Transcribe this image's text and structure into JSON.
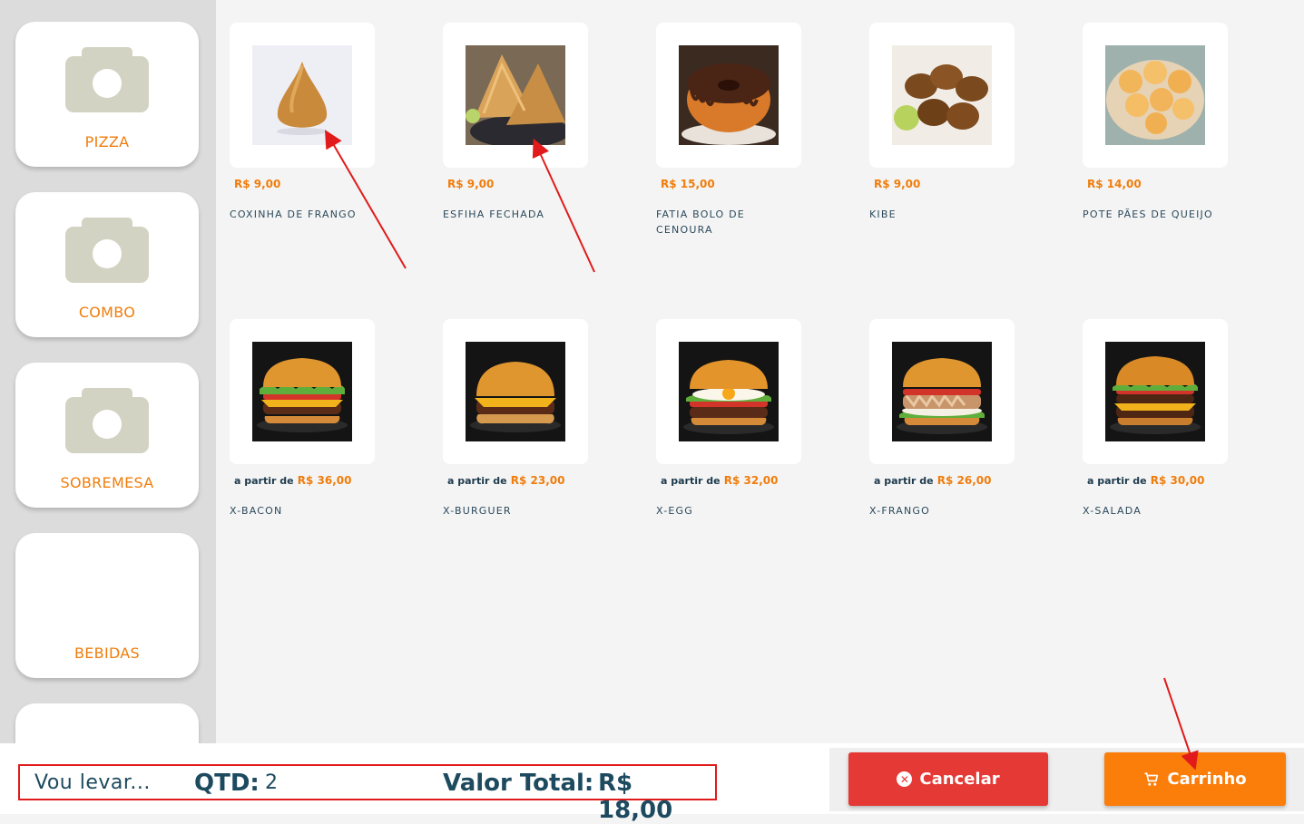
{
  "categories": [
    {
      "label": "PIZZA"
    },
    {
      "label": "COMBO"
    },
    {
      "label": "SOBREMESA"
    },
    {
      "label": "BEBIDAS"
    }
  ],
  "products": [
    {
      "price": "R$ 9,00",
      "name": "COXINHA DE FRANGO",
      "image": "coxinha"
    },
    {
      "price": "R$ 9,00",
      "name": "ESFIHA FECHADA",
      "image": "esfiha"
    },
    {
      "price": "R$ 15,00",
      "name": "FATIA BOLO DE CENOURA",
      "image": "bolo"
    },
    {
      "price": "R$ 9,00",
      "name": "KIBE",
      "image": "kibe"
    },
    {
      "price": "R$ 14,00",
      "name": "POTE PÃES DE QUEIJO",
      "image": "pao-de-queijo"
    },
    {
      "from": "a partir de",
      "price": "R$ 36,00",
      "name": "X-BACON",
      "image": "burger"
    },
    {
      "from": "a partir de",
      "price": "R$ 23,00",
      "name": "X-BURGUER",
      "image": "burger"
    },
    {
      "from": "a partir de",
      "price": "R$ 32,00",
      "name": "X-EGG",
      "image": "burger"
    },
    {
      "from": "a partir de",
      "price": "R$ 26,00",
      "name": "X-FRANGO",
      "image": "burger"
    },
    {
      "from": "a partir de",
      "price": "R$ 30,00",
      "name": "X-SALADA",
      "image": "burger"
    }
  ],
  "summary": {
    "label": "Vou levar...",
    "qty_label": "QTD:",
    "qty_value": "2",
    "total_label": "Valor Total:",
    "total_value": "R$ 18,00"
  },
  "actions": {
    "cancel_label": "Cancelar",
    "cancel_icon": "close-circle-icon",
    "cart_label": "Carrinho",
    "cart_icon": "cart-icon"
  },
  "colors": {
    "accent": "#f07d0c",
    "cancel": "#e53935",
    "cart": "#fb7d0a",
    "text_dark": "#1d4a5e",
    "highlight": "#e11b1b"
  }
}
